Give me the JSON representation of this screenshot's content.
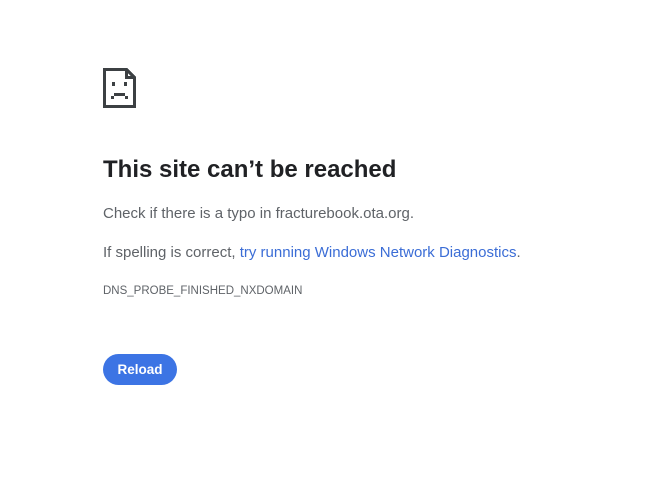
{
  "icon": {
    "name": "sad-page-icon",
    "color": "#3c4043"
  },
  "heading": "This site can’t be reached",
  "typo_message": {
    "text": "Check if there is a typo in fracturebook.ota.org."
  },
  "spelling_message": {
    "prefix": "If spelling is correct, ",
    "link_text": "try running Windows Network Diagnostics",
    "suffix": "."
  },
  "error_code": "DNS_PROBE_FINISHED_NXDOMAIN",
  "reload_button": {
    "label": "Reload"
  },
  "colors": {
    "link": "#3b6dd6",
    "button": "#3c74e4",
    "heading": "#202124",
    "body_text": "#5f6368"
  }
}
